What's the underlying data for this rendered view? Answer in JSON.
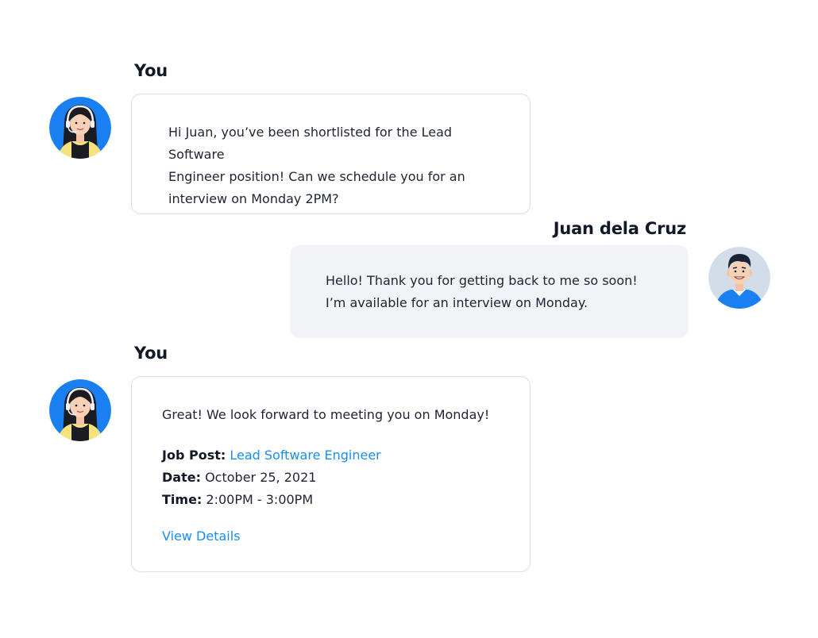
{
  "messages": [
    {
      "sender": "You",
      "text_lines": [
        "Hi Juan, you’ve been shortlisted for the Lead Software",
        "Engineer position! Can we schedule you for an",
        "interview on Monday 2PM?"
      ]
    },
    {
      "sender": "Juan dela Cruz",
      "text_lines": [
        "Hello! Thank you for getting back to me so soon!",
        "I’m available for an interview on Monday."
      ]
    },
    {
      "sender": "You",
      "text": "Great! We look forward to meeting you on Monday!",
      "details": {
        "job_post_label": "Job Post:",
        "job_post_value": "Lead Software Engineer",
        "date_label": "Date:",
        "date_value": "October 25, 2021",
        "time_label": "Time:",
        "time_value": "2:00PM - 3:00PM"
      },
      "view_details": "View Details"
    }
  ],
  "avatars": {
    "recruiter": "recruiter-headset-avatar",
    "candidate": "candidate-male-avatar"
  },
  "colors": {
    "accent": "#1a8cf0",
    "recruiter_avatar_bg": "#1a7ff0",
    "candidate_avatar_bg": "#d3ddea",
    "incoming_bubble_bg": "#f1f3f6",
    "outgoing_bubble_border": "#d7dde8"
  }
}
